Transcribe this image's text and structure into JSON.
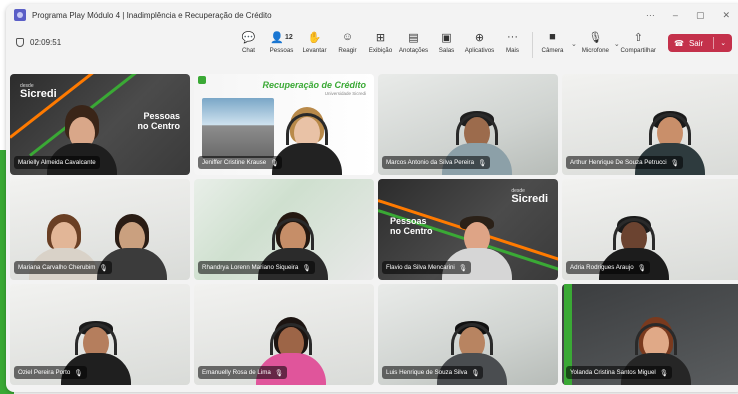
{
  "window": {
    "title": "Programa Play Módulo 4 | Inadimplência e Recuperação de Crédito",
    "controls": [
      "···",
      "–",
      "▢",
      "✕"
    ]
  },
  "toolbar": {
    "timer": "02:09:51",
    "items": [
      {
        "icon": "chat-icon",
        "glyph": "☺",
        "label": "Chat"
      },
      {
        "icon": "people-icon",
        "glyph": "⚇",
        "label": "Pessoas",
        "count": "12"
      },
      {
        "icon": "raise-hand-icon",
        "glyph": "✋",
        "label": "Levantar"
      },
      {
        "icon": "react-icon",
        "glyph": "☺",
        "label": "Reagir"
      },
      {
        "icon": "view-icon",
        "glyph": "⊞",
        "label": "Exibição"
      },
      {
        "icon": "notes-icon",
        "glyph": "▤",
        "label": "Anotações"
      },
      {
        "icon": "rooms-icon",
        "glyph": "▣",
        "label": "Salas"
      },
      {
        "icon": "apps-icon",
        "glyph": "⊕",
        "label": "Aplicativos"
      },
      {
        "icon": "more-icon",
        "glyph": "···",
        "label": "Mais"
      }
    ],
    "devices": [
      {
        "icon": "camera-icon",
        "glyph": "■",
        "label": "Câmera"
      },
      {
        "icon": "microphone-icon",
        "glyph": "🎙",
        "label": "Microfone"
      },
      {
        "icon": "share-icon",
        "glyph": "⇧",
        "label": "Compartilhar"
      }
    ],
    "leave_label": "Sair",
    "leave_color": "#c4314b"
  },
  "slides": {
    "sicredi_logo": "Sicredi",
    "sicredi_sub": "desde",
    "pessoas_centro_1": "Pessoas",
    "pessoas_centro_2": "no Centro",
    "recuperacao": "Recuperação de Crédito",
    "recuperacao_sub": "Universidade Sicredi"
  },
  "participants": [
    {
      "name": "Marielly Almeida Cavalcante"
    },
    {
      "name": "Jeniffer Cristine Krause"
    },
    {
      "name": "Marcos Antonio da Silva Pereira"
    },
    {
      "name": "Arthur Henrique De Souza Petrucci"
    },
    {
      "name": "Mariana Carvalho Cherubim"
    },
    {
      "name": "Rhandrya Lorenn Mariano Siqueira"
    },
    {
      "name": "Flavio da Silva Mencarini"
    },
    {
      "name": "Adria Rodrigues Araujo"
    },
    {
      "name": "Oziel Pereira Porto"
    },
    {
      "name": "Emanuelly Rosa de Lima"
    },
    {
      "name": "Luis Henrique de Souza Silva"
    },
    {
      "name": "Yolanda Cristina Santos Miguel"
    }
  ],
  "colors": {
    "accent": "#3aa935",
    "teams": "#5b5fc7"
  }
}
